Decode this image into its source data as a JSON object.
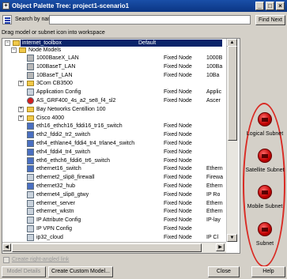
{
  "window": {
    "title": "Object Palette Tree: project1-scenario1",
    "minimize": "_",
    "maximize": "□",
    "close": "×"
  },
  "search": {
    "label": "Search by name:",
    "value": "",
    "find_next": "Find Next"
  },
  "hint": "Drag model or subnet icon into workspace",
  "tree": {
    "root": {
      "label": "internet_toolbox",
      "col1": "Default"
    },
    "group": "Node Models",
    "rows": [
      {
        "label": "1000BaseX_LAN",
        "col1": "Fixed Node",
        "col2": "1000B",
        "icon": "lan-icon"
      },
      {
        "label": "100BaseT_LAN",
        "col1": "Fixed Node",
        "col2": "100Ba",
        "icon": "lan-icon"
      },
      {
        "label": "10BaseT_LAN",
        "col1": "Fixed Node",
        "col2": "10Ba",
        "icon": "lan-icon"
      },
      {
        "label": "3Com CB3500",
        "col1": "",
        "col2": "",
        "icon": "folder-icon"
      },
      {
        "label": "Application Config",
        "col1": "Fixed Node",
        "col2": "Applic",
        "icon": "config-icon"
      },
      {
        "label": "AS_GRF400_4s_a2_se8_f4_sl2",
        "col1": "Fixed Node",
        "col2": "Ascer",
        "icon": "router-icon"
      },
      {
        "label": "Bay Networks Centillion 100",
        "col1": "",
        "col2": "",
        "icon": "folder-icon"
      },
      {
        "label": "Cisco 4000",
        "col1": "",
        "col2": "",
        "icon": "folder-icon"
      },
      {
        "label": "eth16_ethch16_fddi16_tr16_switch",
        "col1": "Fixed Node",
        "col2": "",
        "icon": "switch-icon"
      },
      {
        "label": "eth2_fddi2_tr2_switch",
        "col1": "Fixed Node",
        "col2": "",
        "icon": "switch-icon"
      },
      {
        "label": "eth4_ethlane4_fddi4_tr4_trlane4_switch",
        "col1": "Fixed Node",
        "col2": "",
        "icon": "switch-icon"
      },
      {
        "label": "eth4_fddi4_tr4_switch",
        "col1": "Fixed Node",
        "col2": "",
        "icon": "switch-icon"
      },
      {
        "label": "eth6_ethch6_fddi6_tr6_switch",
        "col1": "Fixed Node",
        "col2": "",
        "icon": "switch-icon"
      },
      {
        "label": "ethernet16_switch",
        "col1": "Fixed Node",
        "col2": "Ethern",
        "icon": "switch-icon"
      },
      {
        "label": "ethernet2_slip8_firewall",
        "col1": "Fixed Node",
        "col2": "Firewa",
        "icon": "firewall-icon"
      },
      {
        "label": "ethernet32_hub",
        "col1": "Fixed Node",
        "col2": "Ethern",
        "icon": "hub-icon"
      },
      {
        "label": "ethernet4_slip8_gtwy",
        "col1": "Fixed Node",
        "col2": "IP Ro",
        "icon": "gateway-icon"
      },
      {
        "label": "ethernet_server",
        "col1": "Fixed Node",
        "col2": "Ethern",
        "icon": "server-icon"
      },
      {
        "label": "ethernet_wkstn",
        "col1": "Fixed Node",
        "col2": "Ethern",
        "icon": "workstation-icon"
      },
      {
        "label": "IP Attribute Config",
        "col1": "Fixed Node",
        "col2": "IP-lay",
        "icon": "config-icon"
      },
      {
        "label": "IP VPN Config",
        "col1": "Fixed Node",
        "col2": "",
        "icon": "config-icon"
      },
      {
        "label": "ip32_cloud",
        "col1": "Fixed Node",
        "col2": "IP Cl",
        "icon": "cloud-icon"
      }
    ]
  },
  "subnets": [
    {
      "label": "Logical Subnet"
    },
    {
      "label": "Satellite Subnet"
    },
    {
      "label": "Mobile Subnet"
    },
    {
      "label": "Subnet"
    }
  ],
  "options": {
    "create_link_label": "Create right-angled link"
  },
  "buttons": {
    "model_details": "Model Details",
    "create_custom_model": "Create Custom Model...",
    "close": "Close",
    "help": "Help"
  }
}
